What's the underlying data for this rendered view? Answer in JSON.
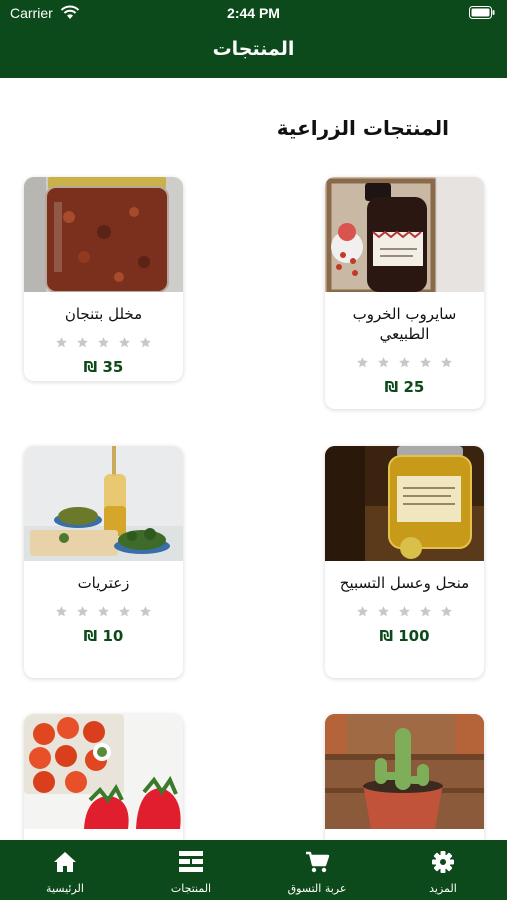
{
  "status_bar": {
    "carrier": "Carrier",
    "time": "2:44 PM"
  },
  "header": {
    "title": "المنتجات"
  },
  "section": {
    "title": "المنتجات الزراعية"
  },
  "products": [
    {
      "name": "سايروب الخروب الطبيعي",
      "price": "25 ₪",
      "rating": 0
    },
    {
      "name": "مخلل بتنجان",
      "price": "35 ₪",
      "rating": 0
    },
    {
      "name": "منحل وعسل التسبيح",
      "price": "100 ₪",
      "rating": 0
    },
    {
      "name": "زعتريات",
      "price": "10 ₪",
      "rating": 0
    }
  ],
  "tab_bar": {
    "items": [
      {
        "label": "المزيد",
        "icon": "gear-icon"
      },
      {
        "label": "عربة التسوق",
        "icon": "cart-icon"
      },
      {
        "label": "المنتجات",
        "icon": "products-list-icon"
      },
      {
        "label": "الرئيسية",
        "icon": "home-icon"
      }
    ]
  },
  "colors": {
    "brand_green": "#0d4a1b",
    "star_gray": "#c8c8c8"
  }
}
